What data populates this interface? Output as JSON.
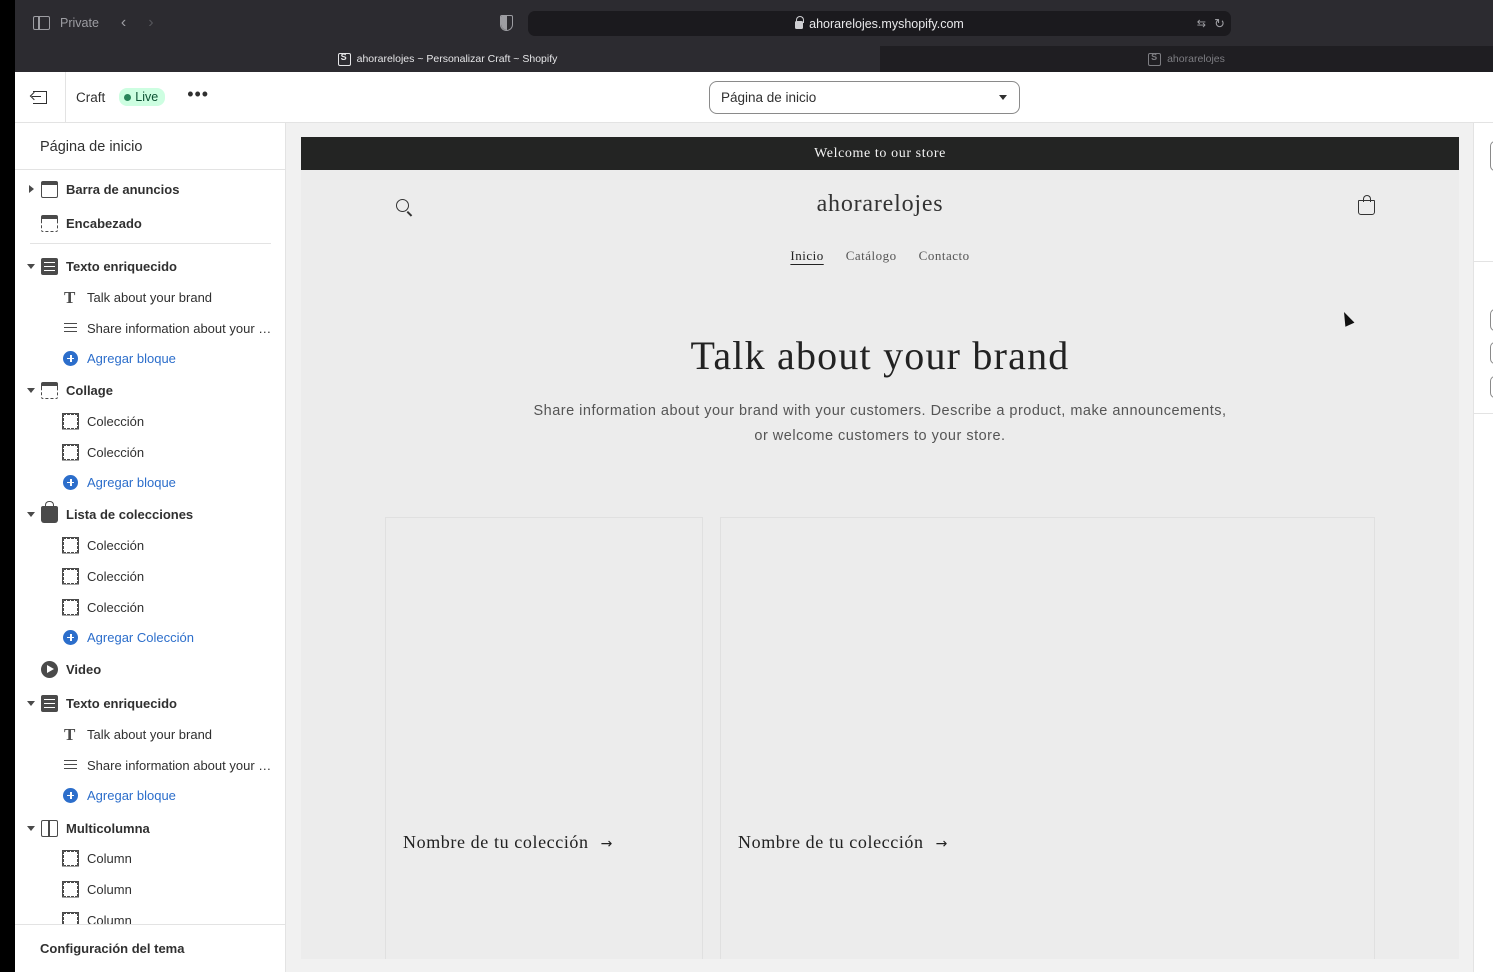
{
  "browser": {
    "private_label": "Private",
    "url": "ahorarelojes.myshopify.com",
    "tabs": [
      {
        "title": "ahorarelojes ~ Personalizar Craft ~ Shopify",
        "active": true
      },
      {
        "title": "ahorarelojes",
        "active": false
      }
    ]
  },
  "editor": {
    "theme_name": "Craft",
    "status_badge": "Live",
    "more_label": "•••",
    "page_selector": "Página de inicio"
  },
  "sidebar": {
    "title": "Página de inicio",
    "sections": [
      {
        "label": "Barra de anuncios",
        "icon": "announcement-bar-icon",
        "expanded": false
      },
      {
        "label": "Encabezado",
        "icon": "header-icon"
      },
      {
        "label": "Texto enriquecido",
        "icon": "rich-text-icon",
        "expanded": true,
        "blocks": [
          {
            "label": "Talk about your brand",
            "icon": "heading-icon"
          },
          {
            "label": "Share information about your brand with your customers.",
            "icon": "text-icon"
          }
        ],
        "add_label": "Agregar bloque"
      },
      {
        "label": "Collage",
        "icon": "collage-icon",
        "expanded": true,
        "blocks": [
          {
            "label": "Colección",
            "icon": "block-frame-icon"
          },
          {
            "label": "Colección",
            "icon": "block-frame-icon"
          }
        ],
        "add_label": "Agregar bloque"
      },
      {
        "label": "Lista de colecciones",
        "icon": "collection-list-icon",
        "expanded": true,
        "blocks": [
          {
            "label": "Colección",
            "icon": "block-frame-icon"
          },
          {
            "label": "Colección",
            "icon": "block-frame-icon"
          },
          {
            "label": "Colección",
            "icon": "block-frame-icon"
          }
        ],
        "add_label": "Agregar Colección"
      },
      {
        "label": "Video",
        "icon": "video-icon"
      },
      {
        "label": "Texto enriquecido",
        "icon": "rich-text-icon",
        "expanded": true,
        "blocks": [
          {
            "label": "Talk about your brand",
            "icon": "heading-icon"
          },
          {
            "label": "Share information about your brand with your customers.",
            "icon": "text-icon"
          }
        ],
        "add_label": "Agregar bloque"
      },
      {
        "label": "Multicolumna",
        "icon": "multicolumn-icon",
        "expanded": true,
        "blocks": [
          {
            "label": "Column",
            "icon": "block-frame-icon"
          },
          {
            "label": "Column",
            "icon": "block-frame-icon"
          },
          {
            "label": "Column",
            "icon": "block-frame-icon"
          }
        ]
      }
    ],
    "footer_label": "Configuración del tema"
  },
  "preview": {
    "announcement": "Welcome to our store",
    "store_name": "ahorarelojes",
    "nav": [
      "Inicio",
      "Catálogo",
      "Contacto"
    ],
    "rich_text_heading": "Talk about your brand",
    "rich_text_body": "Share information about your brand with your customers. Describe a product, make announcements, or welcome customers to your store.",
    "collage_cards": [
      "Nombre de tu colección",
      "Nombre de tu colección"
    ]
  },
  "colors": {
    "live_badge_bg": "#cdfee1",
    "link_blue": "#2c6ecb",
    "announcement_bg": "#232423"
  }
}
